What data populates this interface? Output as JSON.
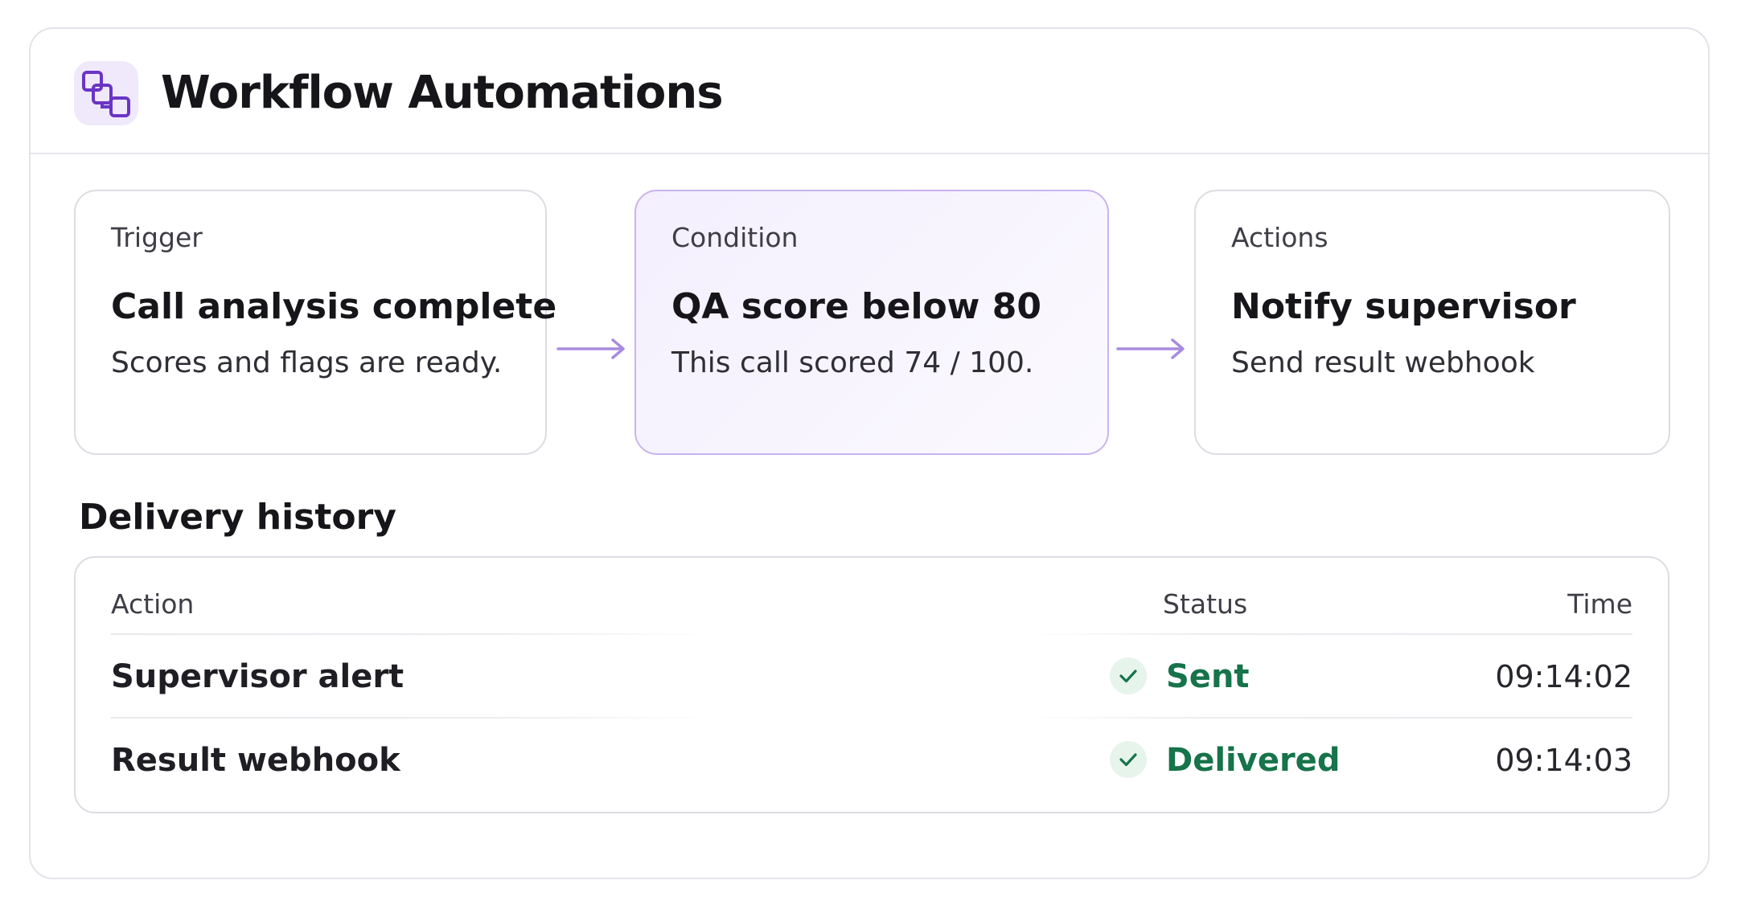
{
  "header": {
    "icon": "workflow-icon",
    "title": "Workflow Automations"
  },
  "steps": [
    {
      "label": "Trigger",
      "title": "Call analysis complete",
      "description": "Scores and flags are ready."
    },
    {
      "label": "Condition",
      "title": "QA score below 80",
      "description": "This call scored 74 / 100."
    },
    {
      "label": "Actions",
      "title": "Notify supervisor",
      "description": "Send result webhook"
    }
  ],
  "delivery": {
    "title": "Delivery history",
    "columns": {
      "action": "Action",
      "status": "Status",
      "time": "Time"
    },
    "rows": [
      {
        "action": "Supervisor alert",
        "status": "Sent",
        "status_icon": "check-icon",
        "time": "09:14:02"
      },
      {
        "action": "Result webhook",
        "status": "Delivered",
        "status_icon": "check-icon",
        "time": "09:14:03"
      }
    ]
  },
  "colors": {
    "accent": "#7c4dcc",
    "accent_bg": "#f0e9fb",
    "success": "#16734a",
    "success_bg": "#e6f4ec"
  }
}
